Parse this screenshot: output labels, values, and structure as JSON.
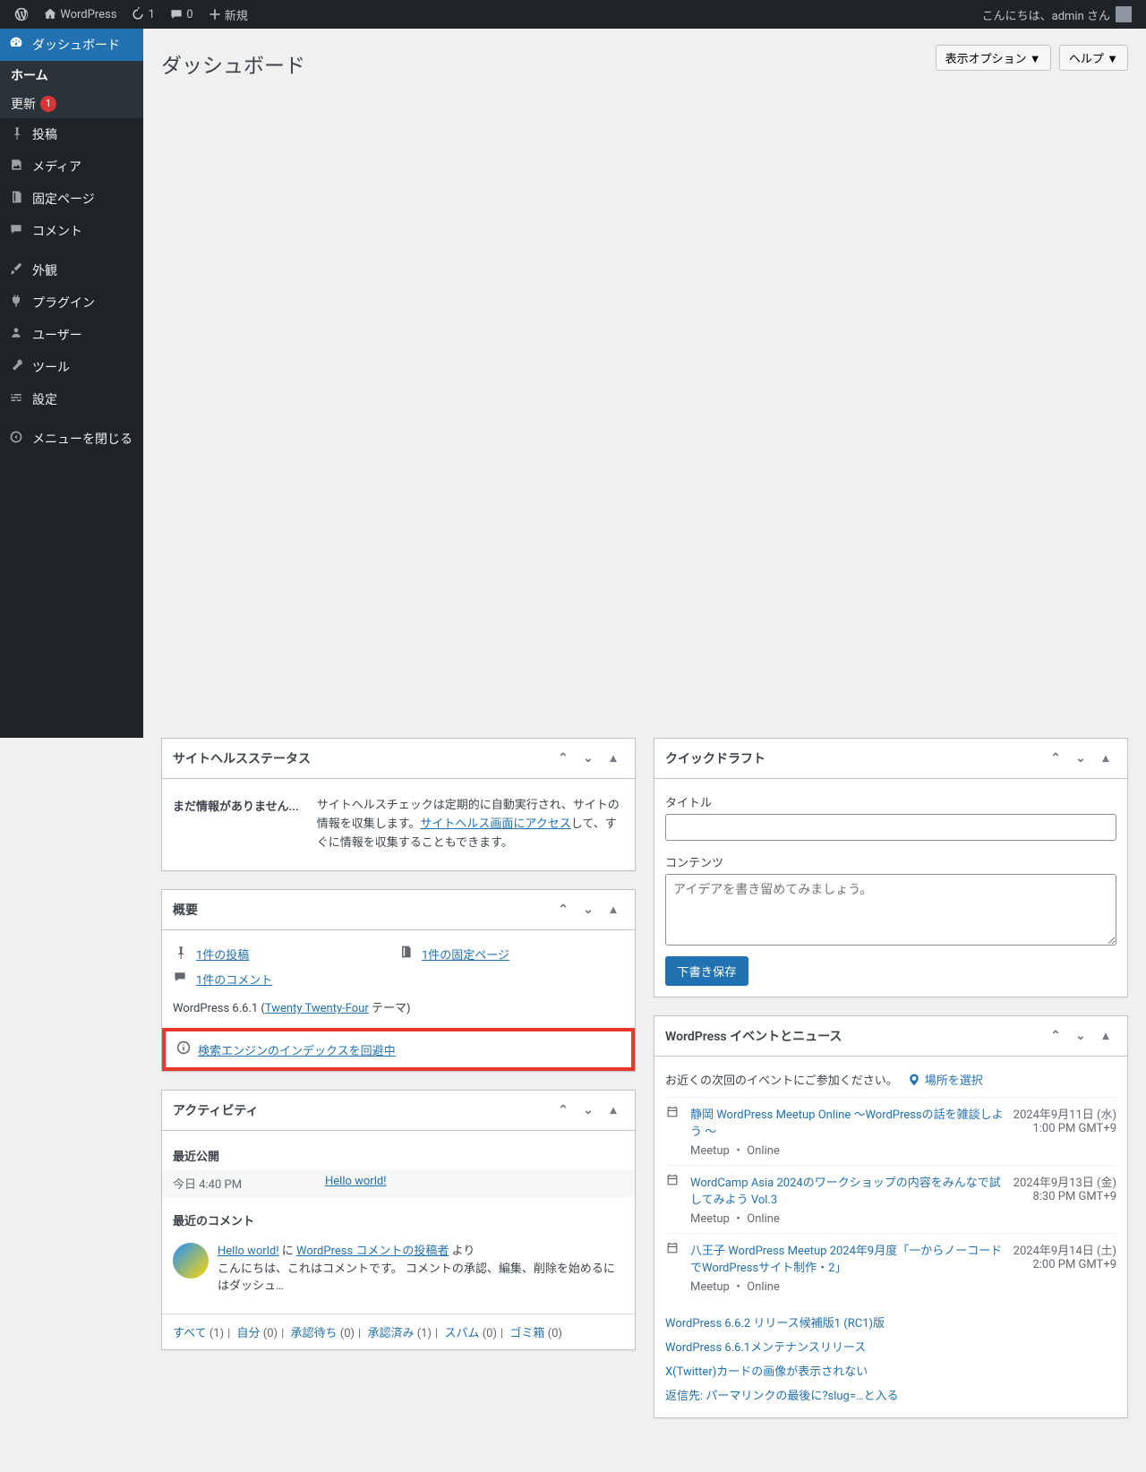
{
  "adminbar": {
    "site": "WordPress",
    "updates": "1",
    "comments": "0",
    "new": "新規",
    "howdy": "こんにちは、admin さん"
  },
  "menu": {
    "dashboard": "ダッシュボード",
    "home": "ホーム",
    "updates": "更新",
    "updates_count": "1",
    "posts": "投稿",
    "media": "メディア",
    "pages": "固定ページ",
    "comments": "コメント",
    "appearance": "外観",
    "plugins": "プラグイン",
    "users": "ユーザー",
    "tools": "ツール",
    "settings": "設定",
    "collapse": "メニューを閉じる"
  },
  "top": {
    "screen_options": "表示オプション ▼",
    "help": "ヘルプ ▼",
    "title": "ダッシュボード"
  },
  "site_health": {
    "title": "サイトヘルスステータス",
    "no_info": "まだ情報がありません...",
    "desc1": "サイトヘルスチェックは定期的に自動実行され、サイトの情報を収集します。",
    "link": "サイトヘルス画面にアクセス",
    "desc2": "して、すぐに情報を収集することもできます。"
  },
  "overview": {
    "title": "概要",
    "posts": "1件の投稿",
    "pages": "1件の固定ページ",
    "comments": "1件のコメント",
    "version_pre": "WordPress 6.6.1 (",
    "theme": "Twenty Twenty-Four",
    "version_post": " テーマ)",
    "seo": "検索エンジンのインデックスを回避中"
  },
  "activity": {
    "title": "アクティビティ",
    "recent_pub": "最近公開",
    "today": "今日 4:40 PM",
    "post": "Hello world!",
    "recent_cm": "最近のコメント",
    "cm_on": "Hello world!",
    "cm_ni": " に ",
    "cm_by": "WordPress コメントの投稿者",
    "cm_yori": " より",
    "cm_body": "こんにちは、これはコメントです。 コメントの承認、編集、削除を始めるにはダッシュ…",
    "all": "すべて",
    "all_n": "(1)",
    "mine": "自分",
    "mine_n": "(0)",
    "pending": "承認待ち",
    "pending_n": "(0)",
    "approved": "承認済み",
    "approved_n": "(1)",
    "spam": "スパム",
    "spam_n": "(0)",
    "trash": "ゴミ箱",
    "trash_n": "(0)"
  },
  "quick": {
    "title": "クイックドラフト",
    "title_lbl": "タイトル",
    "content_lbl": "コンテンツ",
    "placeholder": "アイデアを書き留めてみましょう。",
    "save": "下書き保存"
  },
  "events": {
    "title": "WordPress イベントとニュース",
    "prompt": "お近くの次回のイベントにご参加ください。",
    "select_loc": "場所を選択",
    "items": [
      {
        "t": "静岡 WordPress Meetup Online 〜WordPressの話を雑談しよう 〜",
        "sub": "Meetup ・ Online",
        "d1": "2024年9月11日 (水)",
        "d2": "1:00 PM GMT+9"
      },
      {
        "t": "WordCamp Asia 2024のワークショップの内容をみんなで試してみよう Vol.3",
        "sub": "Meetup ・ Online",
        "d1": "2024年9月13日 (金)",
        "d2": "8:30 PM GMT+9"
      },
      {
        "t": "八王子 WordPress Meetup 2024年9月度「一からノーコードでWordPressサイト制作・2」",
        "sub": "Meetup ・ Online",
        "d1": "2024年9月14日 (土)",
        "d2": "2:00 PM GMT+9"
      }
    ],
    "news": [
      "WordPress 6.6.2 リリース候補版1 (RC1)版",
      "WordPress 6.6.1メンテナンスリリース",
      "X(Twitter)カードの画像が表示されない",
      "返信先: パーマリンクの最後に?slug=…と入る"
    ]
  }
}
